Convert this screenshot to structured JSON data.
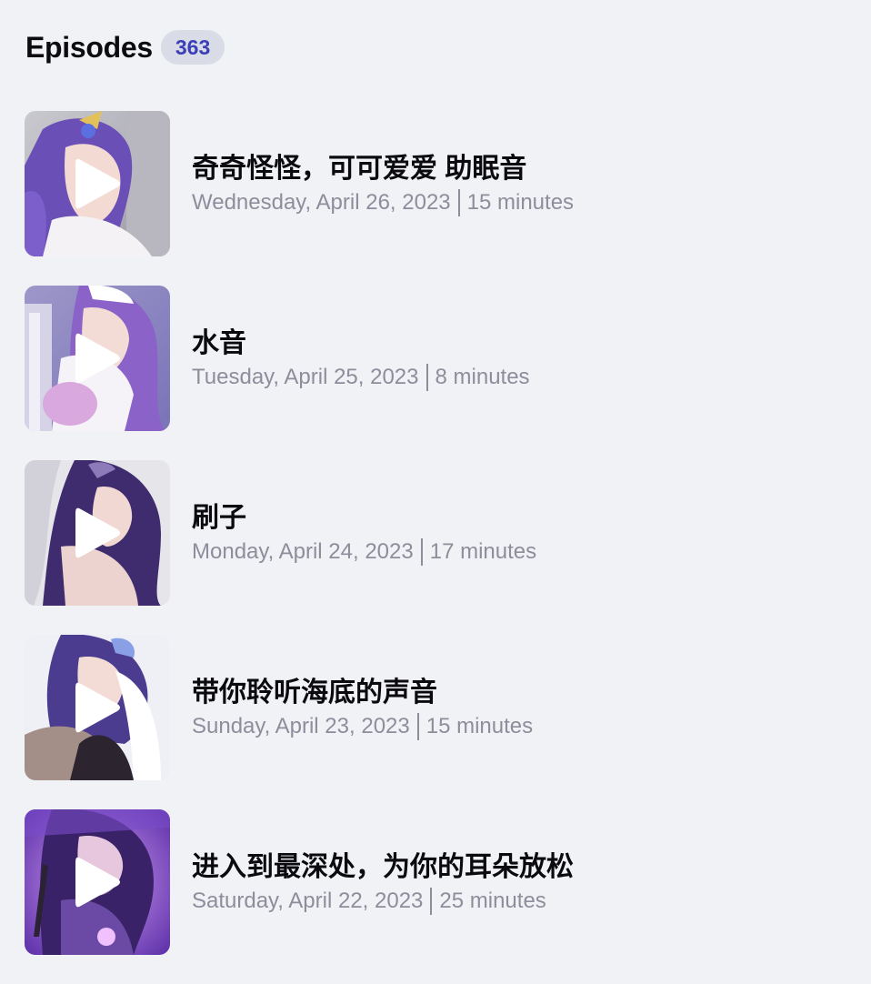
{
  "header": {
    "title": "Episodes",
    "count": "363"
  },
  "episodes": [
    {
      "title": "奇奇怪怪，可可爱爱 助眠音",
      "date": "Wednesday, April 26, 2023",
      "duration": "15 minutes",
      "thumbnail_icon": "anime-cover-image"
    },
    {
      "title": "水音",
      "date": "Tuesday, April 25, 2023",
      "duration": "8 minutes",
      "thumbnail_icon": "anime-cover-image"
    },
    {
      "title": "刷子",
      "date": "Monday, April 24, 2023",
      "duration": "17 minutes",
      "thumbnail_icon": "anime-cover-image"
    },
    {
      "title": "带你聆听海底的声音",
      "date": "Sunday, April 23, 2023",
      "duration": "15 minutes",
      "thumbnail_icon": "anime-cover-image"
    },
    {
      "title": "进入到最深处，为你的耳朵放松",
      "date": "Saturday, April 22, 2023",
      "duration": "25 minutes",
      "thumbnail_icon": "anime-cover-image"
    }
  ],
  "colors": {
    "background": "#f1f2f6",
    "badge_bg": "#d9dbe6",
    "badge_text": "#3b3fb8",
    "subtitle": "#8e8d9c"
  }
}
